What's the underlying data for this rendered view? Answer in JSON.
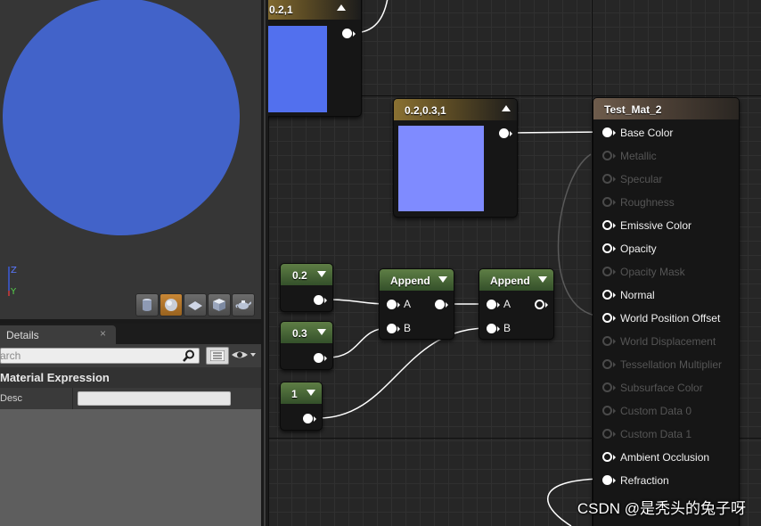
{
  "viewport": {
    "sphere_color": "#4263c9",
    "toolbar": [
      {
        "icon": "cylinder-icon"
      },
      {
        "icon": "sphere-icon",
        "active": true
      },
      {
        "icon": "plane-icon"
      },
      {
        "icon": "cube-icon"
      },
      {
        "icon": "teapot-icon"
      }
    ]
  },
  "details": {
    "tab_label": "Details",
    "close_glyph": "×",
    "search_placeholder": "Search",
    "search_visible": "arch",
    "section_title": "Material Expression",
    "desc_label": "Desc",
    "desc_value": ""
  },
  "graph": {
    "node_top_left": {
      "title": "0.2,1",
      "swatch": "#5270ee"
    },
    "node_const4": {
      "title": "0.2,0.3,1",
      "swatch": "#7f8bff"
    },
    "const_a": {
      "value": "0.2"
    },
    "const_b": {
      "value": "0.3"
    },
    "const_c": {
      "value": "1"
    },
    "append_1": {
      "title": "Append",
      "in_a": "A",
      "in_b": "B"
    },
    "append_2": {
      "title": "Append",
      "in_a": "A",
      "in_b": "B"
    },
    "material": {
      "title": "Test_Mat_2",
      "inputs": [
        {
          "label": "Base Color",
          "state": "connected"
        },
        {
          "label": "Metallic",
          "state": "disabled"
        },
        {
          "label": "Specular",
          "state": "disabled"
        },
        {
          "label": "Roughness",
          "state": "disabled"
        },
        {
          "label": "Emissive Color",
          "state": "open"
        },
        {
          "label": "Opacity",
          "state": "open"
        },
        {
          "label": "Opacity Mask",
          "state": "disabled"
        },
        {
          "label": "Normal",
          "state": "open"
        },
        {
          "label": "World Position Offset",
          "state": "open"
        },
        {
          "label": "World Displacement",
          "state": "disabled"
        },
        {
          "label": "Tessellation Multiplier",
          "state": "disabled"
        },
        {
          "label": "Subsurface Color",
          "state": "disabled"
        },
        {
          "label": "Custom Data 0",
          "state": "disabled"
        },
        {
          "label": "Custom Data 1",
          "state": "disabled"
        },
        {
          "label": "Ambient Occlusion",
          "state": "open"
        },
        {
          "label": "Refraction",
          "state": "connected"
        }
      ]
    }
  },
  "watermark": "CSDN @是秃头的兔子呀"
}
